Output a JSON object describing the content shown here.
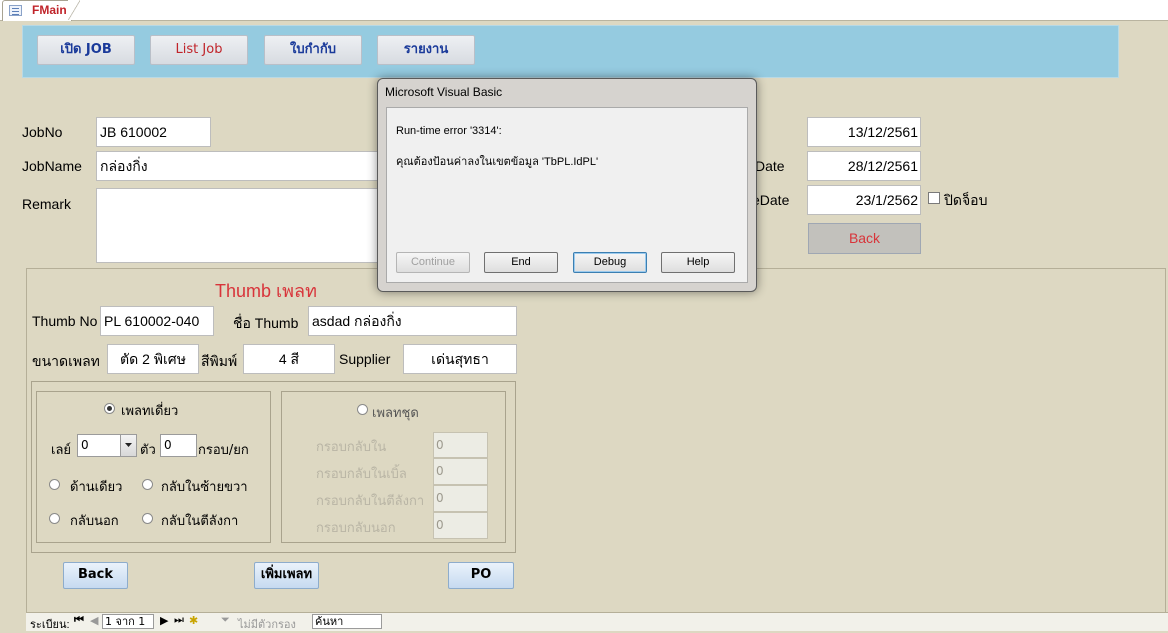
{
  "tab": {
    "label": "FMain",
    "icon": "form-icon"
  },
  "nav": [
    {
      "label": "เปิด JOB",
      "color": "#1a3a9a"
    },
    {
      "label": "List Job",
      "color": "#c0242a"
    },
    {
      "label": "ใบกำกับ",
      "color": "#1a3a9a"
    },
    {
      "label": "รายงาน",
      "color": "#1a3a9a"
    }
  ],
  "job": {
    "jobno_label": "JobNo",
    "jobno": "JB 610002",
    "jobname_label": "JobName",
    "jobname": "กล่องกิ่ง",
    "remark_label": "Remark",
    "remark": "",
    "date1": "13/12/2561",
    "date2_label_fragment": "Date",
    "date2": "28/12/2561",
    "date3_label_fragment": "eDate",
    "date3": "23/1/2562",
    "close_job_label": "ปิดจ็อบ",
    "back_label": "Back"
  },
  "thumb": {
    "section_title": "Thumb เพลท",
    "thumbno_label": "Thumb No",
    "thumbno": "PL 610002-040",
    "thumbname_label": "ชื่อ Thumb",
    "thumbname": "asdad กล่องกิ่ง",
    "size_label": "ขนาดเพลท",
    "size": "ตัด 2 พิเศษ",
    "color_label": "สีพิมพ์",
    "color": "4 สี",
    "supplier_label": "Supplier",
    "supplier": "เด่นสุทธา"
  },
  "single_plate": {
    "radio_label": "เพลทเดี่ยว",
    "number_label": "เลย์",
    "number_value": "0",
    "tua_label": "ตัว",
    "tua_value": "0",
    "krob_label": "กรอบ/ยก",
    "opt1": "ด้านเดียว",
    "opt2": "กลับในซ้ายขวา",
    "opt3": "กลับนอก",
    "opt4": "กลับในตีลังกา"
  },
  "set_plate": {
    "radio_label": "เพลทชุด",
    "rows": [
      {
        "label": "กรอบกลับใน",
        "value": "0"
      },
      {
        "label": "กรอบกลับในเบิ้ล",
        "value": "0"
      },
      {
        "label": "กรอบกลับในตีลังกา",
        "value": "0"
      },
      {
        "label": "กรอบกลับนอก",
        "value": "0"
      }
    ]
  },
  "actions": {
    "back": "Back",
    "add_plate": "เพิ่มเพลท",
    "po": "PO"
  },
  "dialog": {
    "title": "Microsoft Visual Basic",
    "error_line": "Run-time error '3314':",
    "message": "คุณต้องป้อนค่าลงในเขตข้อมูล 'TbPL.IdPL'",
    "buttons": {
      "continue": "Continue",
      "end": "End",
      "debug": "Debug",
      "help": "Help"
    }
  },
  "recnav": {
    "record_label": "ระเบียน:",
    "position": "1 จาก 1",
    "filter_label": "ไม่มีตัวกรอง",
    "search_placeholder": "ค้นหา"
  }
}
